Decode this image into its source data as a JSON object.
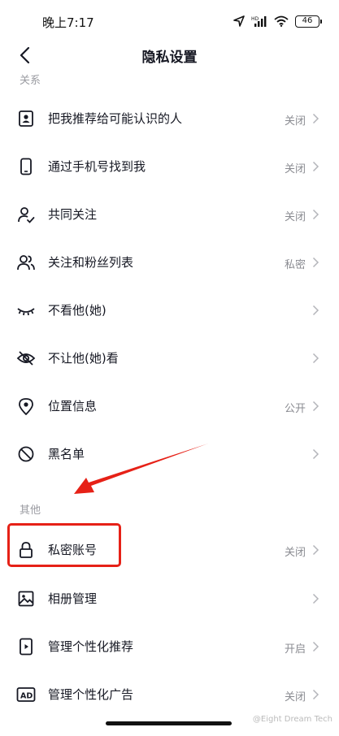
{
  "status_bar": {
    "time": "晚上7:17",
    "battery": "46",
    "icons": [
      "location-icon",
      "signal-icon",
      "wifi-icon",
      "battery-icon"
    ]
  },
  "nav": {
    "title": "隐私设置",
    "back_icon": "back-chevron-icon"
  },
  "sections": [
    {
      "header": "关系",
      "items": [
        {
          "label": "把我推荐给可能认识的人",
          "value": "关闭",
          "icon": "contact-card-icon"
        },
        {
          "label": "通过手机号找到我",
          "value": "关闭",
          "icon": "phone-icon"
        },
        {
          "label": "共同关注",
          "value": "关闭",
          "icon": "user-check-icon"
        },
        {
          "label": "关注和粉丝列表",
          "value": "私密",
          "icon": "users-icon"
        },
        {
          "label": "不看他(她)",
          "value": "",
          "icon": "eye-closed-icon"
        },
        {
          "label": "不让他(她)看",
          "value": "",
          "icon": "eye-slash-icon"
        },
        {
          "label": "位置信息",
          "value": "公开",
          "icon": "location-pin-icon"
        },
        {
          "label": "黑名单",
          "value": "",
          "icon": "block-icon"
        }
      ]
    },
    {
      "header": "其他",
      "items": [
        {
          "label": "私密账号",
          "value": "关闭",
          "icon": "lock-icon"
        },
        {
          "label": "相册管理",
          "value": "",
          "icon": "image-icon"
        },
        {
          "label": "管理个性化推荐",
          "value": "开启",
          "icon": "play-card-icon"
        },
        {
          "label": "管理个性化广告",
          "value": "关闭",
          "icon": "ad-icon"
        }
      ]
    }
  ],
  "annotation": {
    "highlight_color": "#e62117",
    "arrow_color": "#e62117"
  },
  "watermark": "@Eight Dream Tech"
}
